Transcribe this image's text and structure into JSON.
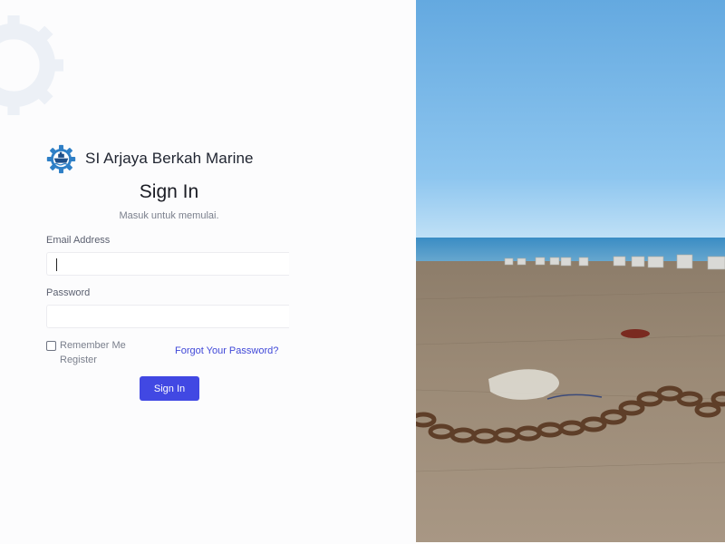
{
  "brand": {
    "name": "SI Arjaya Berkah Marine",
    "logo_icon": "gear-ship-logo-icon",
    "accent": "#2e7fc6"
  },
  "form": {
    "title": "Sign In",
    "subtitle": "Masuk untuk memulai.",
    "email_label": "Email Address",
    "email_value": "",
    "password_label": "Password",
    "password_value": "",
    "remember_label": "Remember Me",
    "remember_checked": false,
    "register_label": "Register",
    "forgot_label": "Forgot Your Password?",
    "submit_label": "Sign In",
    "button_color": "#4148e3",
    "link_color": "#4048d8"
  },
  "hero": {
    "scene": "beach-with-anchor-chain-photo"
  }
}
